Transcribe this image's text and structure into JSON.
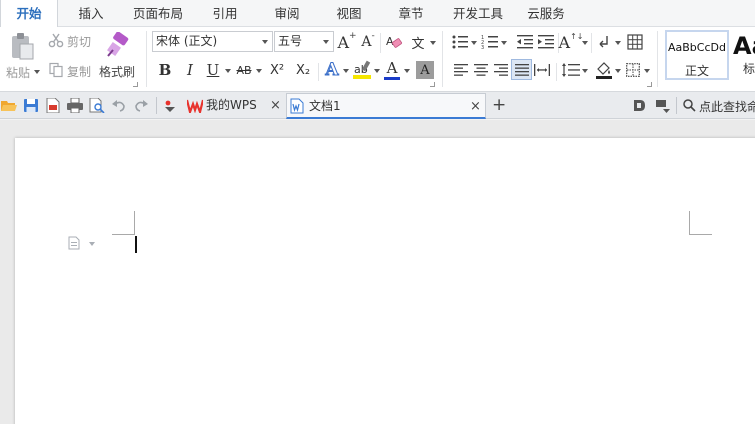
{
  "menu": {
    "tabs": [
      "开始",
      "插入",
      "页面布局",
      "引用",
      "审阅",
      "视图",
      "章节",
      "开发工具",
      "云服务"
    ],
    "active_index": 0
  },
  "clipboard": {
    "paste_label": "粘贴",
    "cut_label": "剪切",
    "copy_label": "复制",
    "format_painter_label": "格式刷"
  },
  "font": {
    "name_value": "宋体 (正文)",
    "size_value": "五号",
    "bold_glyph": "B",
    "italic_glyph": "I",
    "underline_glyph": "U",
    "strike_glyph": "AB",
    "superscript_glyph": "X²",
    "subscript_glyph": "X₂",
    "grow_glyph": "A",
    "shrink_glyph": "A",
    "phonetic_glyph": "文",
    "effect_glyph": "A",
    "color_glyph": "A",
    "shade_glyph": "A",
    "colors": {
      "highlight": "#f5e600",
      "font_color": "#1a3cc8"
    }
  },
  "styles": {
    "normal_preview": "AaBbCcDd",
    "normal_label": "正文",
    "heading_preview": "Aa",
    "heading_label": "标"
  },
  "quickbar": {
    "search_label": "点此查找命"
  },
  "doc_tabs": [
    {
      "label": "我的WPS",
      "close": "×"
    },
    {
      "label": "文档1",
      "close": "×"
    }
  ],
  "new_tab_glyph": "+",
  "accent": "#2c6fbd",
  "wps_red": "#e8332d"
}
